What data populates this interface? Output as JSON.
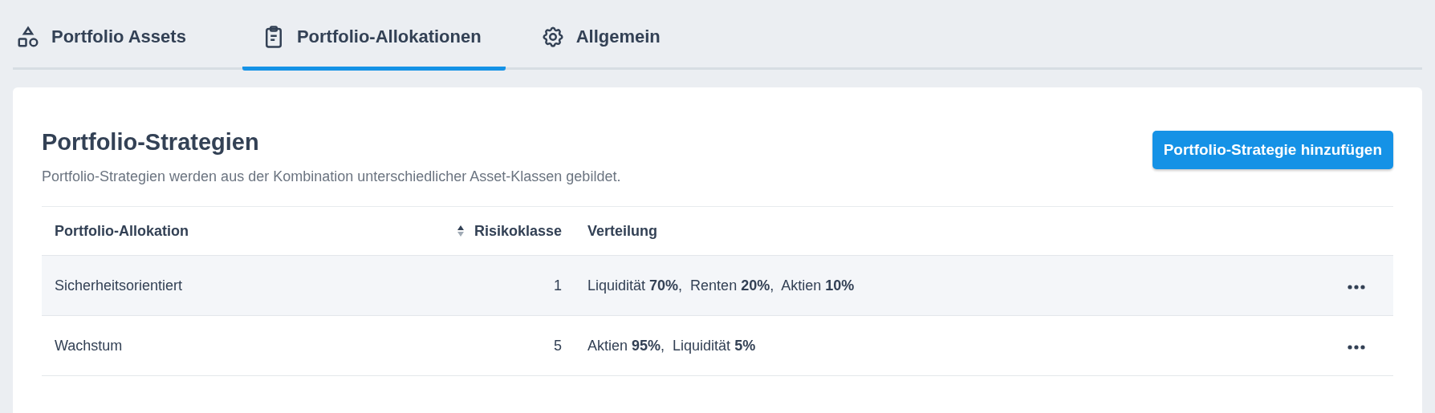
{
  "tabs": [
    {
      "label": "Portfolio Assets",
      "selected": false
    },
    {
      "label": "Portfolio-Allokationen",
      "selected": true
    },
    {
      "label": "Allgemein",
      "selected": false
    }
  ],
  "card": {
    "title": "Portfolio-Strategien",
    "description": "Portfolio-Strategien werden aus der Kombination unterschiedlicher Asset-Klassen gebildet.",
    "add_button": "Portfolio-Strategie hinzufügen"
  },
  "table": {
    "columns": [
      {
        "label": "Portfolio-Allokation"
      },
      {
        "label": "Risikoklasse"
      },
      {
        "label": "Verteilung"
      }
    ],
    "rows": [
      {
        "name": "Sicherheitsorientiert",
        "risk_class": "1",
        "distribution": "Liquidität **70%**,  Renten **20%**,  Aktien **10%**"
      },
      {
        "name": "Wachstum",
        "risk_class": "5",
        "distribution": "Aktien **95%**,  Liquidität **5%**"
      }
    ]
  }
}
